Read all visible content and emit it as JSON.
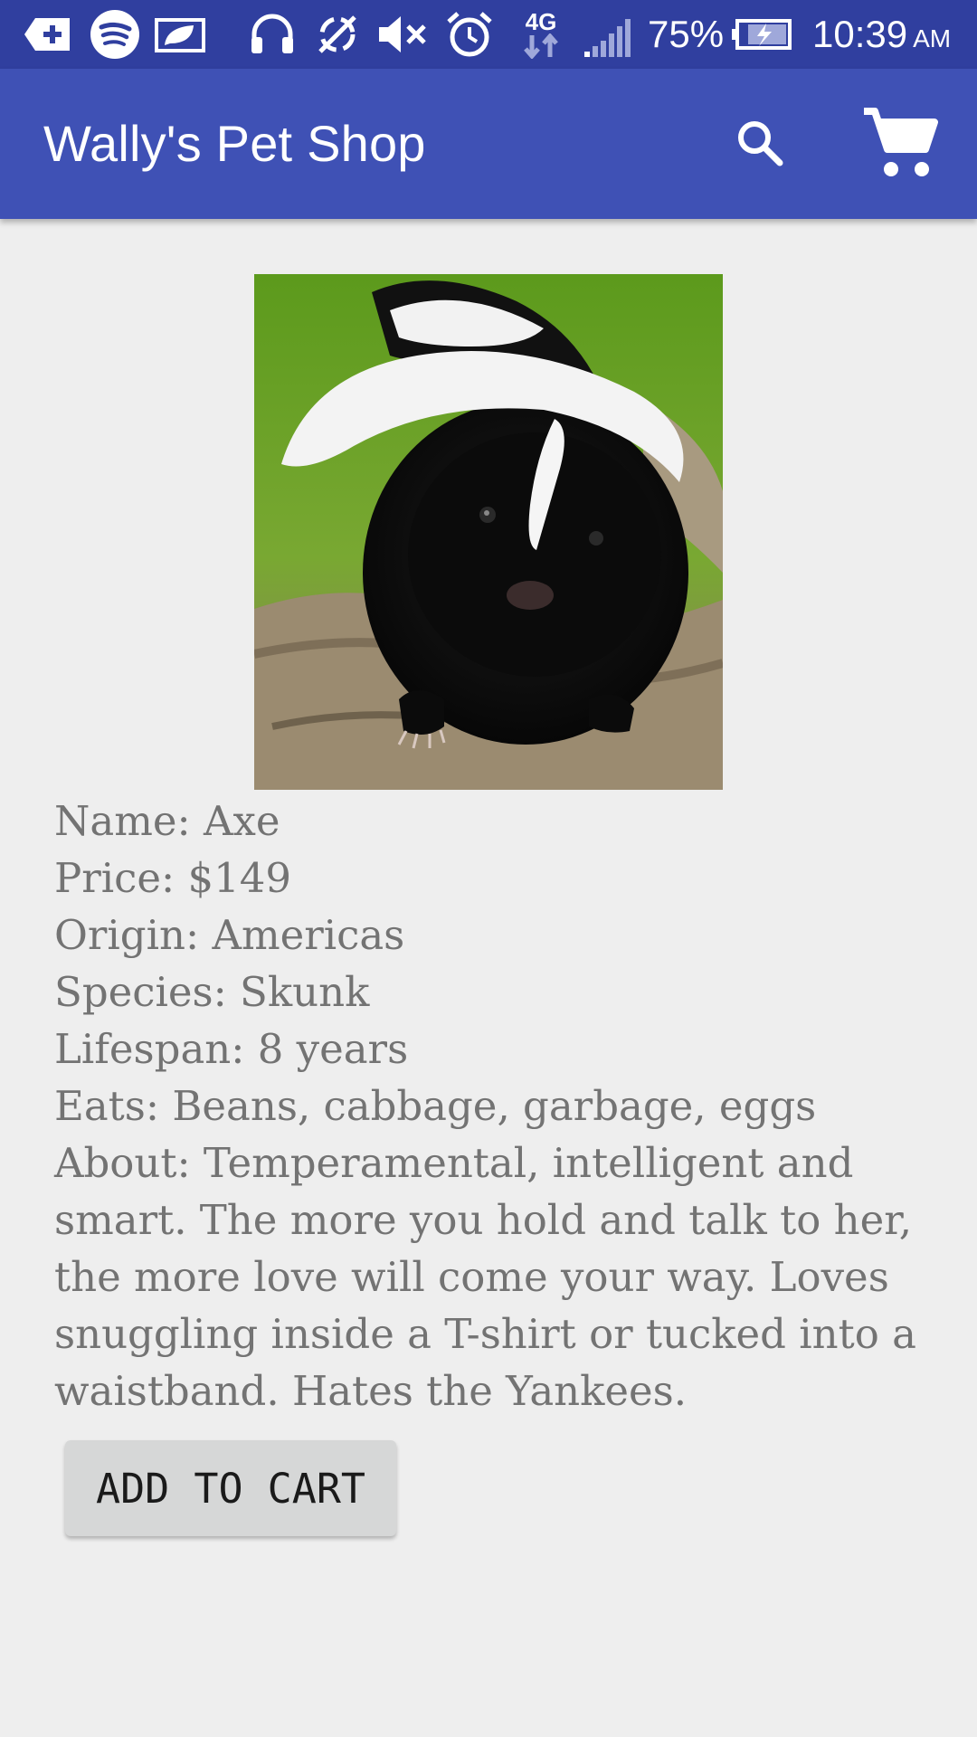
{
  "status_bar": {
    "icons": [
      "plus-shield-icon",
      "spotify-icon",
      "leaf-card-icon",
      "headset-icon",
      "sync-off-icon",
      "mute-icon",
      "alarm-icon",
      "network-4g-icon",
      "signal-icon",
      "battery-charging-icon"
    ],
    "network_label": "4G",
    "battery_percent": "75%",
    "time": "10:39",
    "ampm": "AM"
  },
  "toolbar": {
    "title": "Wally's Pet Shop",
    "icons": [
      "search-icon",
      "cart-icon"
    ]
  },
  "pet": {
    "image_icon": "skunk-photo",
    "name": "Name: Axe",
    "price": "Price: $149",
    "origin": "Origin: Americas",
    "species": "Species: Skunk",
    "lifespan": "Lifespan: 8 years",
    "eats": "Eats: Beans, cabbage, garbage, eggs",
    "about": "About: Temperamental, intelligent and smart. The more you hold and talk to her, the more love will come your way. Loves snuggling inside a T-shirt or tucked into a waistband. Hates the Yankees."
  },
  "actions": {
    "add_to_cart": "ADD TO CART"
  },
  "colors": {
    "status_bar": "#303f9f",
    "toolbar": "#3f51b5",
    "background": "#eeeeee",
    "text": "#737373",
    "button": "#d6d7d7"
  }
}
